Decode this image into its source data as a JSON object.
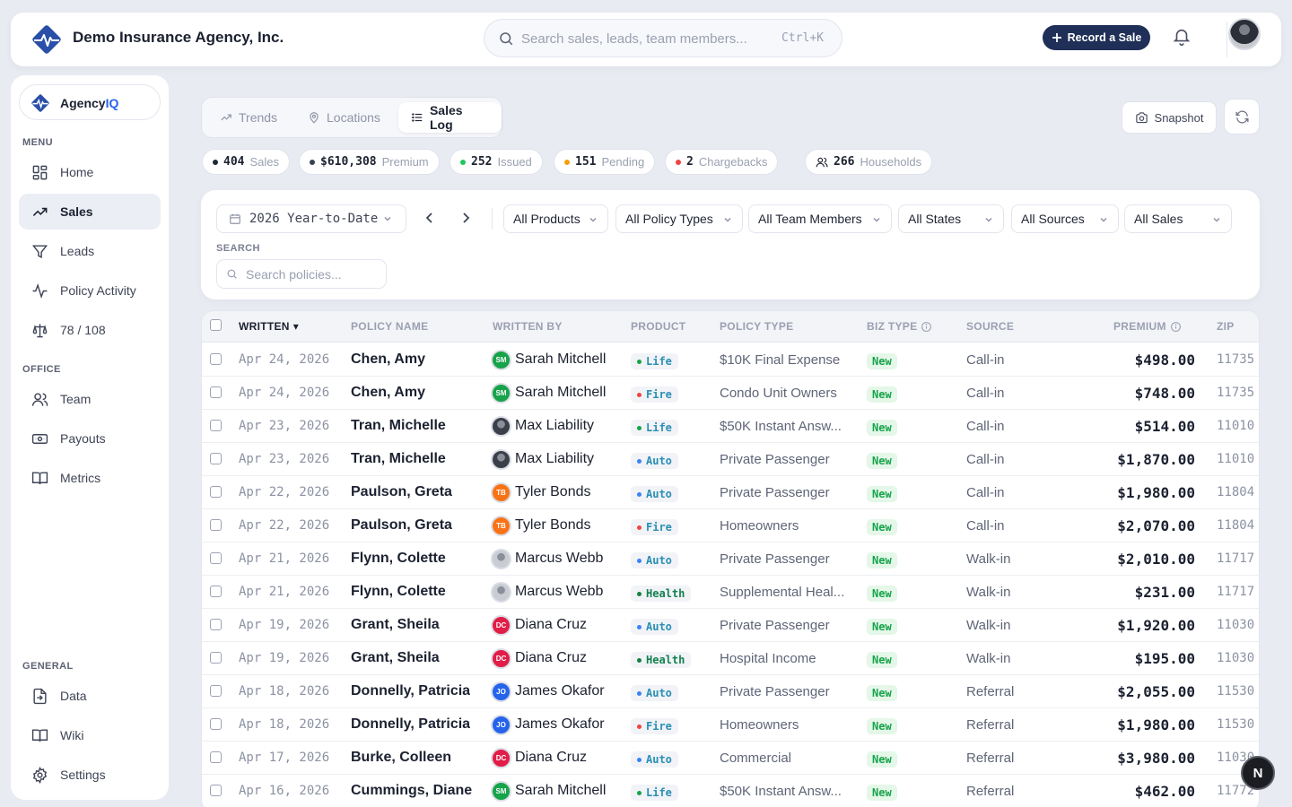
{
  "header": {
    "company_name": "Demo Insurance Agency, Inc.",
    "search_placeholder": "Search sales, leads, team members...",
    "search_shortcut": "Ctrl+K",
    "record_label": "Record a Sale"
  },
  "sidebar": {
    "brand_prefix": "Agency",
    "brand_suffix": "IQ",
    "sections": {
      "menu": "MENU",
      "office": "OFFICE",
      "general": "GENERAL"
    },
    "menu_items": [
      {
        "label": "Home",
        "icon": "grid-icon"
      },
      {
        "label": "Sales",
        "icon": "trending-up-icon",
        "active": true
      },
      {
        "label": "Leads",
        "icon": "filter-icon"
      },
      {
        "label": "Policy Activity",
        "icon": "activity-icon"
      },
      {
        "label": "78 / 108",
        "icon": "scale-icon"
      }
    ],
    "office_items": [
      {
        "label": "Team",
        "icon": "users-icon"
      },
      {
        "label": "Payouts",
        "icon": "payout-icon"
      },
      {
        "label": "Metrics",
        "icon": "book-icon"
      }
    ],
    "general_items": [
      {
        "label": "Data",
        "icon": "file-import-icon"
      },
      {
        "label": "Wiki",
        "icon": "book-icon"
      },
      {
        "label": "Settings",
        "icon": "gear-icon"
      }
    ]
  },
  "tabs": [
    {
      "label": "Trends",
      "icon": "trending-up-icon"
    },
    {
      "label": "Locations",
      "icon": "map-pin-icon"
    },
    {
      "label": "Sales Log",
      "icon": "list-icon",
      "active": true
    }
  ],
  "actions": {
    "snapshot_label": "Snapshot"
  },
  "stats": [
    {
      "value": "404",
      "label": "Sales",
      "color": "#1f2937"
    },
    {
      "value": "$610,308",
      "label": "Premium",
      "color": "#374151"
    },
    {
      "value": "252",
      "label": "Issued",
      "color": "#22c55e"
    },
    {
      "value": "151",
      "label": "Pending",
      "color": "#f59e0b"
    },
    {
      "value": "2",
      "label": "Chargebacks",
      "color": "#ef4444"
    },
    {
      "value": "266",
      "label": "Households",
      "color": ""
    }
  ],
  "filters": {
    "period": "2026 Year-to-Date",
    "products": "All Products",
    "policy_types": "All Policy Types",
    "team_members": "All Team Members",
    "states": "All States",
    "sources": "All Sources",
    "sales": "All Sales",
    "search_label": "SEARCH",
    "search_placeholder": "Search policies..."
  },
  "table": {
    "columns": [
      "WRITTEN",
      "POLICY NAME",
      "WRITTEN BY",
      "PRODUCT",
      "POLICY TYPE",
      "BIZ TYPE",
      "SOURCE",
      "PREMIUM",
      "ZIP"
    ],
    "sort_indicator": "▾",
    "product_colors": {
      "Life": "#16a34a",
      "Fire": "#ef4444",
      "Auto": "#3b82f6",
      "Health": "#15803d"
    },
    "product_text_colors": {
      "Life": "#2a8fb5",
      "Fire": "#2a8fb5",
      "Auto": "#2a8fb5",
      "Health": "#13804f"
    },
    "agents": {
      "Sarah Mitchell": {
        "initials": "SM",
        "color": "#16a34a"
      },
      "Max Liability": {
        "initials": "",
        "color": "#3b3f4a"
      },
      "Tyler Bonds": {
        "initials": "TB",
        "color": "#f97316"
      },
      "Marcus Webb": {
        "initials": "",
        "color": "#c9ccd3"
      },
      "Diana Cruz": {
        "initials": "DC",
        "color": "#e11d48"
      },
      "James Okafor": {
        "initials": "JO",
        "color": "#2563eb"
      }
    },
    "rows": [
      {
        "date": "Apr 24, 2026",
        "name": "Chen, Amy",
        "agent": "Sarah Mitchell",
        "product": "Life",
        "type": "$10K Final Expense",
        "biz": "New",
        "source": "Call-in",
        "premium": "$498.00",
        "zip": "11735"
      },
      {
        "date": "Apr 24, 2026",
        "name": "Chen, Amy",
        "agent": "Sarah Mitchell",
        "product": "Fire",
        "type": "Condo Unit Owners",
        "biz": "New",
        "source": "Call-in",
        "premium": "$748.00",
        "zip": "11735"
      },
      {
        "date": "Apr 23, 2026",
        "name": "Tran, Michelle",
        "agent": "Max Liability",
        "product": "Life",
        "type": "$50K Instant Answ...",
        "biz": "New",
        "source": "Call-in",
        "premium": "$514.00",
        "zip": "11010"
      },
      {
        "date": "Apr 23, 2026",
        "name": "Tran, Michelle",
        "agent": "Max Liability",
        "product": "Auto",
        "type": "Private Passenger",
        "biz": "New",
        "source": "Call-in",
        "premium": "$1,870.00",
        "zip": "11010"
      },
      {
        "date": "Apr 22, 2026",
        "name": "Paulson, Greta",
        "agent": "Tyler Bonds",
        "product": "Auto",
        "type": "Private Passenger",
        "biz": "New",
        "source": "Call-in",
        "premium": "$1,980.00",
        "zip": "11804"
      },
      {
        "date": "Apr 22, 2026",
        "name": "Paulson, Greta",
        "agent": "Tyler Bonds",
        "product": "Fire",
        "type": "Homeowners",
        "biz": "New",
        "source": "Call-in",
        "premium": "$2,070.00",
        "zip": "11804"
      },
      {
        "date": "Apr 21, 2026",
        "name": "Flynn, Colette",
        "agent": "Marcus Webb",
        "product": "Auto",
        "type": "Private Passenger",
        "biz": "New",
        "source": "Walk-in",
        "premium": "$2,010.00",
        "zip": "11717"
      },
      {
        "date": "Apr 21, 2026",
        "name": "Flynn, Colette",
        "agent": "Marcus Webb",
        "product": "Health",
        "type": "Supplemental Heal...",
        "biz": "New",
        "source": "Walk-in",
        "premium": "$231.00",
        "zip": "11717"
      },
      {
        "date": "Apr 19, 2026",
        "name": "Grant, Sheila",
        "agent": "Diana Cruz",
        "product": "Auto",
        "type": "Private Passenger",
        "biz": "New",
        "source": "Walk-in",
        "premium": "$1,920.00",
        "zip": "11030"
      },
      {
        "date": "Apr 19, 2026",
        "name": "Grant, Sheila",
        "agent": "Diana Cruz",
        "product": "Health",
        "type": "Hospital Income",
        "biz": "New",
        "source": "Walk-in",
        "premium": "$195.00",
        "zip": "11030"
      },
      {
        "date": "Apr 18, 2026",
        "name": "Donnelly, Patricia",
        "agent": "James Okafor",
        "product": "Auto",
        "type": "Private Passenger",
        "biz": "New",
        "source": "Referral",
        "premium": "$2,055.00",
        "zip": "11530"
      },
      {
        "date": "Apr 18, 2026",
        "name": "Donnelly, Patricia",
        "agent": "James Okafor",
        "product": "Fire",
        "type": "Homeowners",
        "biz": "New",
        "source": "Referral",
        "premium": "$1,980.00",
        "zip": "11530"
      },
      {
        "date": "Apr 17, 2026",
        "name": "Burke, Colleen",
        "agent": "Diana Cruz",
        "product": "Auto",
        "type": "Commercial",
        "biz": "New",
        "source": "Referral",
        "premium": "$3,980.00",
        "zip": "11030"
      },
      {
        "date": "Apr 16, 2026",
        "name": "Cummings, Diane",
        "agent": "Sarah Mitchell",
        "product": "Life",
        "type": "$50K Instant Answ...",
        "biz": "New",
        "source": "Referral",
        "premium": "$462.00",
        "zip": "11772"
      }
    ]
  },
  "fab_label": "N"
}
